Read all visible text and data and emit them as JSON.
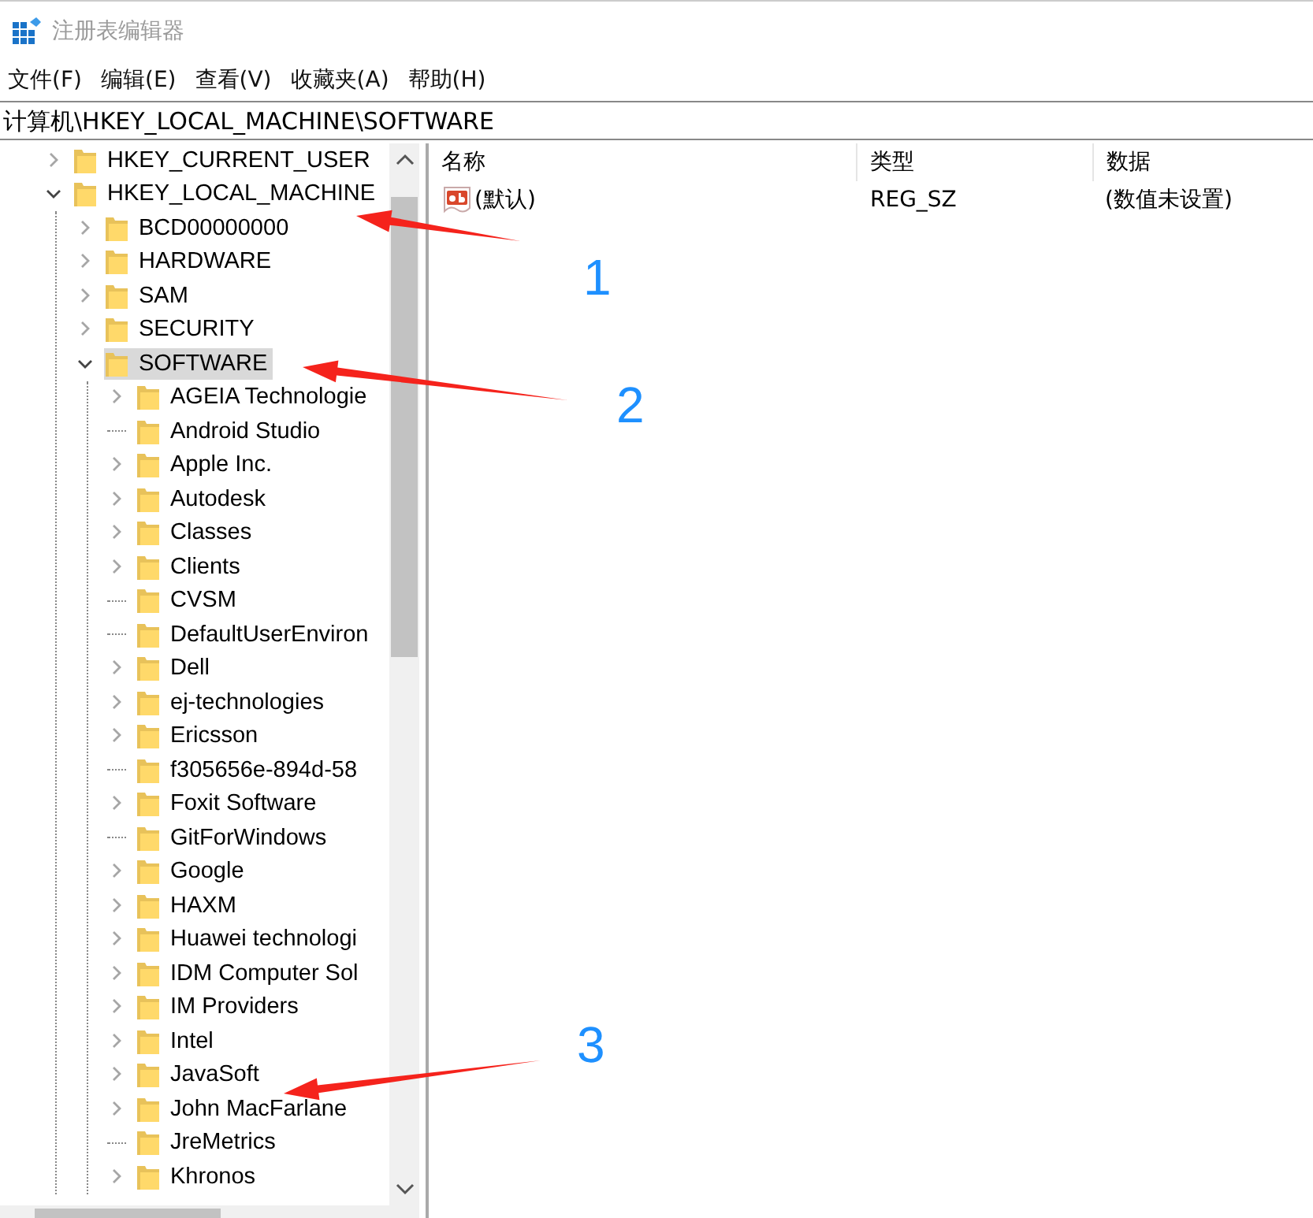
{
  "window": {
    "title": "注册表编辑器"
  },
  "menu": [
    {
      "label": "文件(F)"
    },
    {
      "label": "编辑(E)"
    },
    {
      "label": "查看(V)"
    },
    {
      "label": "收藏夹(A)"
    },
    {
      "label": "帮助(H)"
    }
  ],
  "address": "计算机\\HKEY_LOCAL_MACHINE\\SOFTWARE",
  "tree": [
    {
      "label": "HKEY_CURRENT_USER",
      "expandable": true,
      "expanded": false,
      "selected": false
    },
    {
      "label": "HKEY_LOCAL_MACHINE",
      "expandable": true,
      "expanded": true,
      "selected": false,
      "children": [
        {
          "label": "BCD00000000",
          "expandable": true,
          "expanded": false,
          "selected": false
        },
        {
          "label": "HARDWARE",
          "expandable": true,
          "expanded": false,
          "selected": false
        },
        {
          "label": "SAM",
          "expandable": true,
          "expanded": false,
          "selected": false
        },
        {
          "label": "SECURITY",
          "expandable": true,
          "expanded": false,
          "selected": false
        },
        {
          "label": "SOFTWARE",
          "expandable": true,
          "expanded": true,
          "selected": true,
          "children": [
            {
              "label": "AGEIA Technologie",
              "expandable": true,
              "expanded": false,
              "selected": false
            },
            {
              "label": "Android Studio",
              "expandable": false,
              "selected": false
            },
            {
              "label": "Apple Inc.",
              "expandable": true,
              "expanded": false,
              "selected": false
            },
            {
              "label": "Autodesk",
              "expandable": true,
              "expanded": false,
              "selected": false
            },
            {
              "label": "Classes",
              "expandable": true,
              "expanded": false,
              "selected": false
            },
            {
              "label": "Clients",
              "expandable": true,
              "expanded": false,
              "selected": false
            },
            {
              "label": "CVSM",
              "expandable": false,
              "selected": false
            },
            {
              "label": "DefaultUserEnviron",
              "expandable": false,
              "selected": false
            },
            {
              "label": "Dell",
              "expandable": true,
              "expanded": false,
              "selected": false
            },
            {
              "label": "ej-technologies",
              "expandable": true,
              "expanded": false,
              "selected": false
            },
            {
              "label": "Ericsson",
              "expandable": true,
              "expanded": false,
              "selected": false
            },
            {
              "label": "f305656e-894d-58",
              "expandable": false,
              "selected": false
            },
            {
              "label": "Foxit Software",
              "expandable": true,
              "expanded": false,
              "selected": false
            },
            {
              "label": "GitForWindows",
              "expandable": false,
              "selected": false
            },
            {
              "label": "Google",
              "expandable": true,
              "expanded": false,
              "selected": false
            },
            {
              "label": "HAXM",
              "expandable": true,
              "expanded": false,
              "selected": false
            },
            {
              "label": "Huawei technologi",
              "expandable": true,
              "expanded": false,
              "selected": false
            },
            {
              "label": "IDM Computer Sol",
              "expandable": true,
              "expanded": false,
              "selected": false
            },
            {
              "label": "IM Providers",
              "expandable": true,
              "expanded": false,
              "selected": false
            },
            {
              "label": "Intel",
              "expandable": true,
              "expanded": false,
              "selected": false
            },
            {
              "label": "JavaSoft",
              "expandable": true,
              "expanded": false,
              "selected": false
            },
            {
              "label": "John MacFarlane",
              "expandable": true,
              "expanded": false,
              "selected": false
            },
            {
              "label": "JreMetrics",
              "expandable": false,
              "selected": false
            },
            {
              "label": "Khronos",
              "expandable": true,
              "expanded": false,
              "selected": false
            }
          ]
        }
      ]
    }
  ],
  "values": {
    "columns": [
      "名称",
      "类型",
      "数据"
    ],
    "rows": [
      {
        "name": "(默认)",
        "type": "REG_SZ",
        "data": "(数值未设置)"
      }
    ]
  },
  "annotations": [
    {
      "label": "1"
    },
    {
      "label": "2"
    },
    {
      "label": "3"
    }
  ]
}
